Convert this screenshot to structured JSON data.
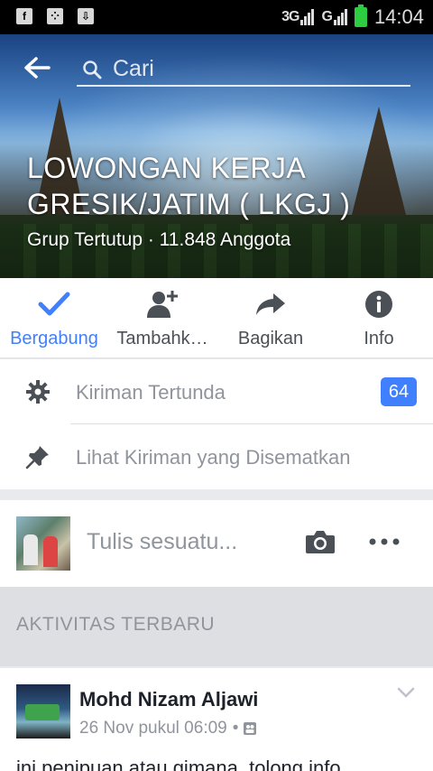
{
  "status_bar": {
    "network1": "3G",
    "network2": "G",
    "time": "14:04",
    "left_icons": [
      "facebook-icon",
      "blackberry-messenger-icon",
      "download-icon"
    ]
  },
  "header": {
    "search_placeholder": "Cari"
  },
  "group": {
    "title": "LOWONGAN KERJA GRESIK/JATIM ( LKGJ )",
    "subtitle": "Grup Tertutup · 11.848 Anggota"
  },
  "actions": [
    {
      "label": "Bergabung",
      "icon": "check-icon",
      "active": true
    },
    {
      "label": "Tambahk…",
      "icon": "add-person-icon",
      "active": false
    },
    {
      "label": "Bagikan",
      "icon": "share-icon",
      "active": false
    },
    {
      "label": "Info",
      "icon": "info-icon",
      "active": false
    }
  ],
  "admin": {
    "pending_label": "Kiriman Tertunda",
    "pending_count": "64",
    "pinned_label": "Lihat Kiriman yang Disematkan"
  },
  "composer": {
    "placeholder": "Tulis sesuatu..."
  },
  "section": {
    "recent_header": "AKTIVITAS TERBARU"
  },
  "post": {
    "author": "Mohd Nizam Aljawi",
    "time": "26 Nov pukul 06:09",
    "separator": "•",
    "body": "ini penipuan atau gimana, tolong info"
  },
  "colors": {
    "accent": "#4080ff",
    "muted_text": "#90949c",
    "icon_gray": "#4b4f56"
  }
}
